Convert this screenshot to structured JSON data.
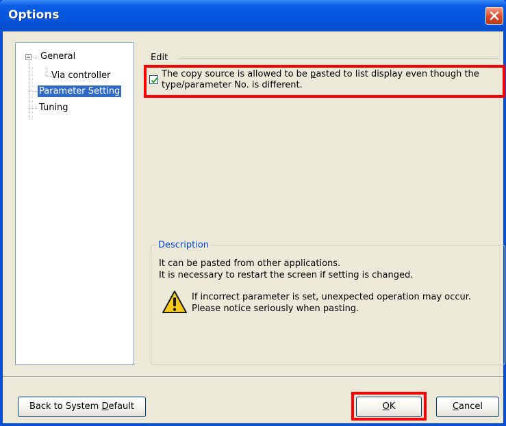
{
  "window": {
    "title": "Options"
  },
  "tree": {
    "items": [
      {
        "label": "General"
      },
      {
        "label": "Via controller"
      },
      {
        "label": "Parameter Setting"
      },
      {
        "label": "Tuning"
      }
    ]
  },
  "edit_group": {
    "label": "Edit",
    "checkbox": {
      "checked": true,
      "label_line1_pre": "The copy source is allowed to be ",
      "label_line1_mnemonic": "p",
      "label_line1_post": "asted to list display even though the",
      "label_line2": "type/parameter No. is different."
    }
  },
  "description": {
    "title": "Description",
    "line1": "It can be pasted from other applications.",
    "line2": "It is necessary to restart the screen if setting is changed.",
    "warning_icon": "warning-icon",
    "warning_line1": "If incorrect parameter is set, unexpected operation may occur.",
    "warning_line2": "Please notice seriously when pasting."
  },
  "buttons": {
    "default_pre": "Back to System ",
    "default_mnemonic": "D",
    "default_post": "efault",
    "ok_mnemonic": "O",
    "ok_post": "K",
    "cancel_mnemonic": "C",
    "cancel_post": "ancel"
  },
  "colors": {
    "title_bar": "#0655de",
    "highlight": "#ff0000",
    "selection": "#316ac5",
    "description_title": "#0046d5"
  }
}
